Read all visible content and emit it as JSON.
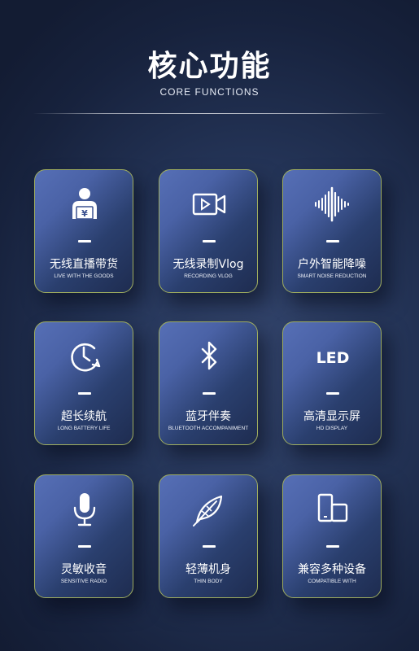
{
  "header": {
    "title": "核心功能",
    "subtitle": "CORE FUNCTIONS"
  },
  "cards": [
    {
      "icon": "live-user-icon",
      "cn": "无线直播带货",
      "en": "LIVE WITH THE GOODS"
    },
    {
      "icon": "video-camera-icon",
      "cn": "无线录制Vlog",
      "en": "RECORDING VLOG"
    },
    {
      "icon": "sound-wave-icon",
      "cn": "户外智能降噪",
      "en": "SMART NOISE REDUCTION"
    },
    {
      "icon": "clock-icon",
      "cn": "超长续航",
      "en": "LONG BATTERY LIFE"
    },
    {
      "icon": "bluetooth-icon",
      "cn": "蓝牙伴奏",
      "en": "BLUETOOTH ACCOMPANIMENT"
    },
    {
      "icon": "led-icon",
      "icon_text": "LED",
      "cn": "高清显示屏",
      "en": "HD DISPLAY"
    },
    {
      "icon": "microphone-icon",
      "cn": "灵敏收音",
      "en": "SENSITIVE RADIO"
    },
    {
      "icon": "feather-icon",
      "cn": "轻薄机身",
      "en": "THIN BODY"
    },
    {
      "icon": "devices-icon",
      "cn": "兼容多种设备",
      "en": "COMPATIBLE WITH"
    }
  ],
  "colors": {
    "background": "#1b2745",
    "card_border": "#9eac5e",
    "card_fill": "#4a62a6",
    "text": "#ffffff"
  }
}
